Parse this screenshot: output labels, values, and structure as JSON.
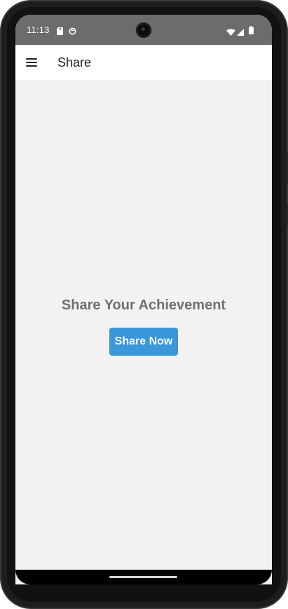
{
  "status_bar": {
    "time": "11:13",
    "icons": [
      "sd-card-icon",
      "sync-icon",
      "wifi-icon",
      "signal-icon",
      "battery-icon"
    ]
  },
  "app_bar": {
    "menu_icon": "hamburger-menu-icon",
    "title": "Share"
  },
  "main": {
    "headline": "Share Your Achievement",
    "share_button_label": "Share Now"
  },
  "colors": {
    "status_bar_bg": "#6c6c6c",
    "app_bar_bg": "#ffffff",
    "content_bg": "#f2f2f2",
    "headline_text": "#707070",
    "button_bg": "#3a97da",
    "button_text": "#ffffff"
  }
}
